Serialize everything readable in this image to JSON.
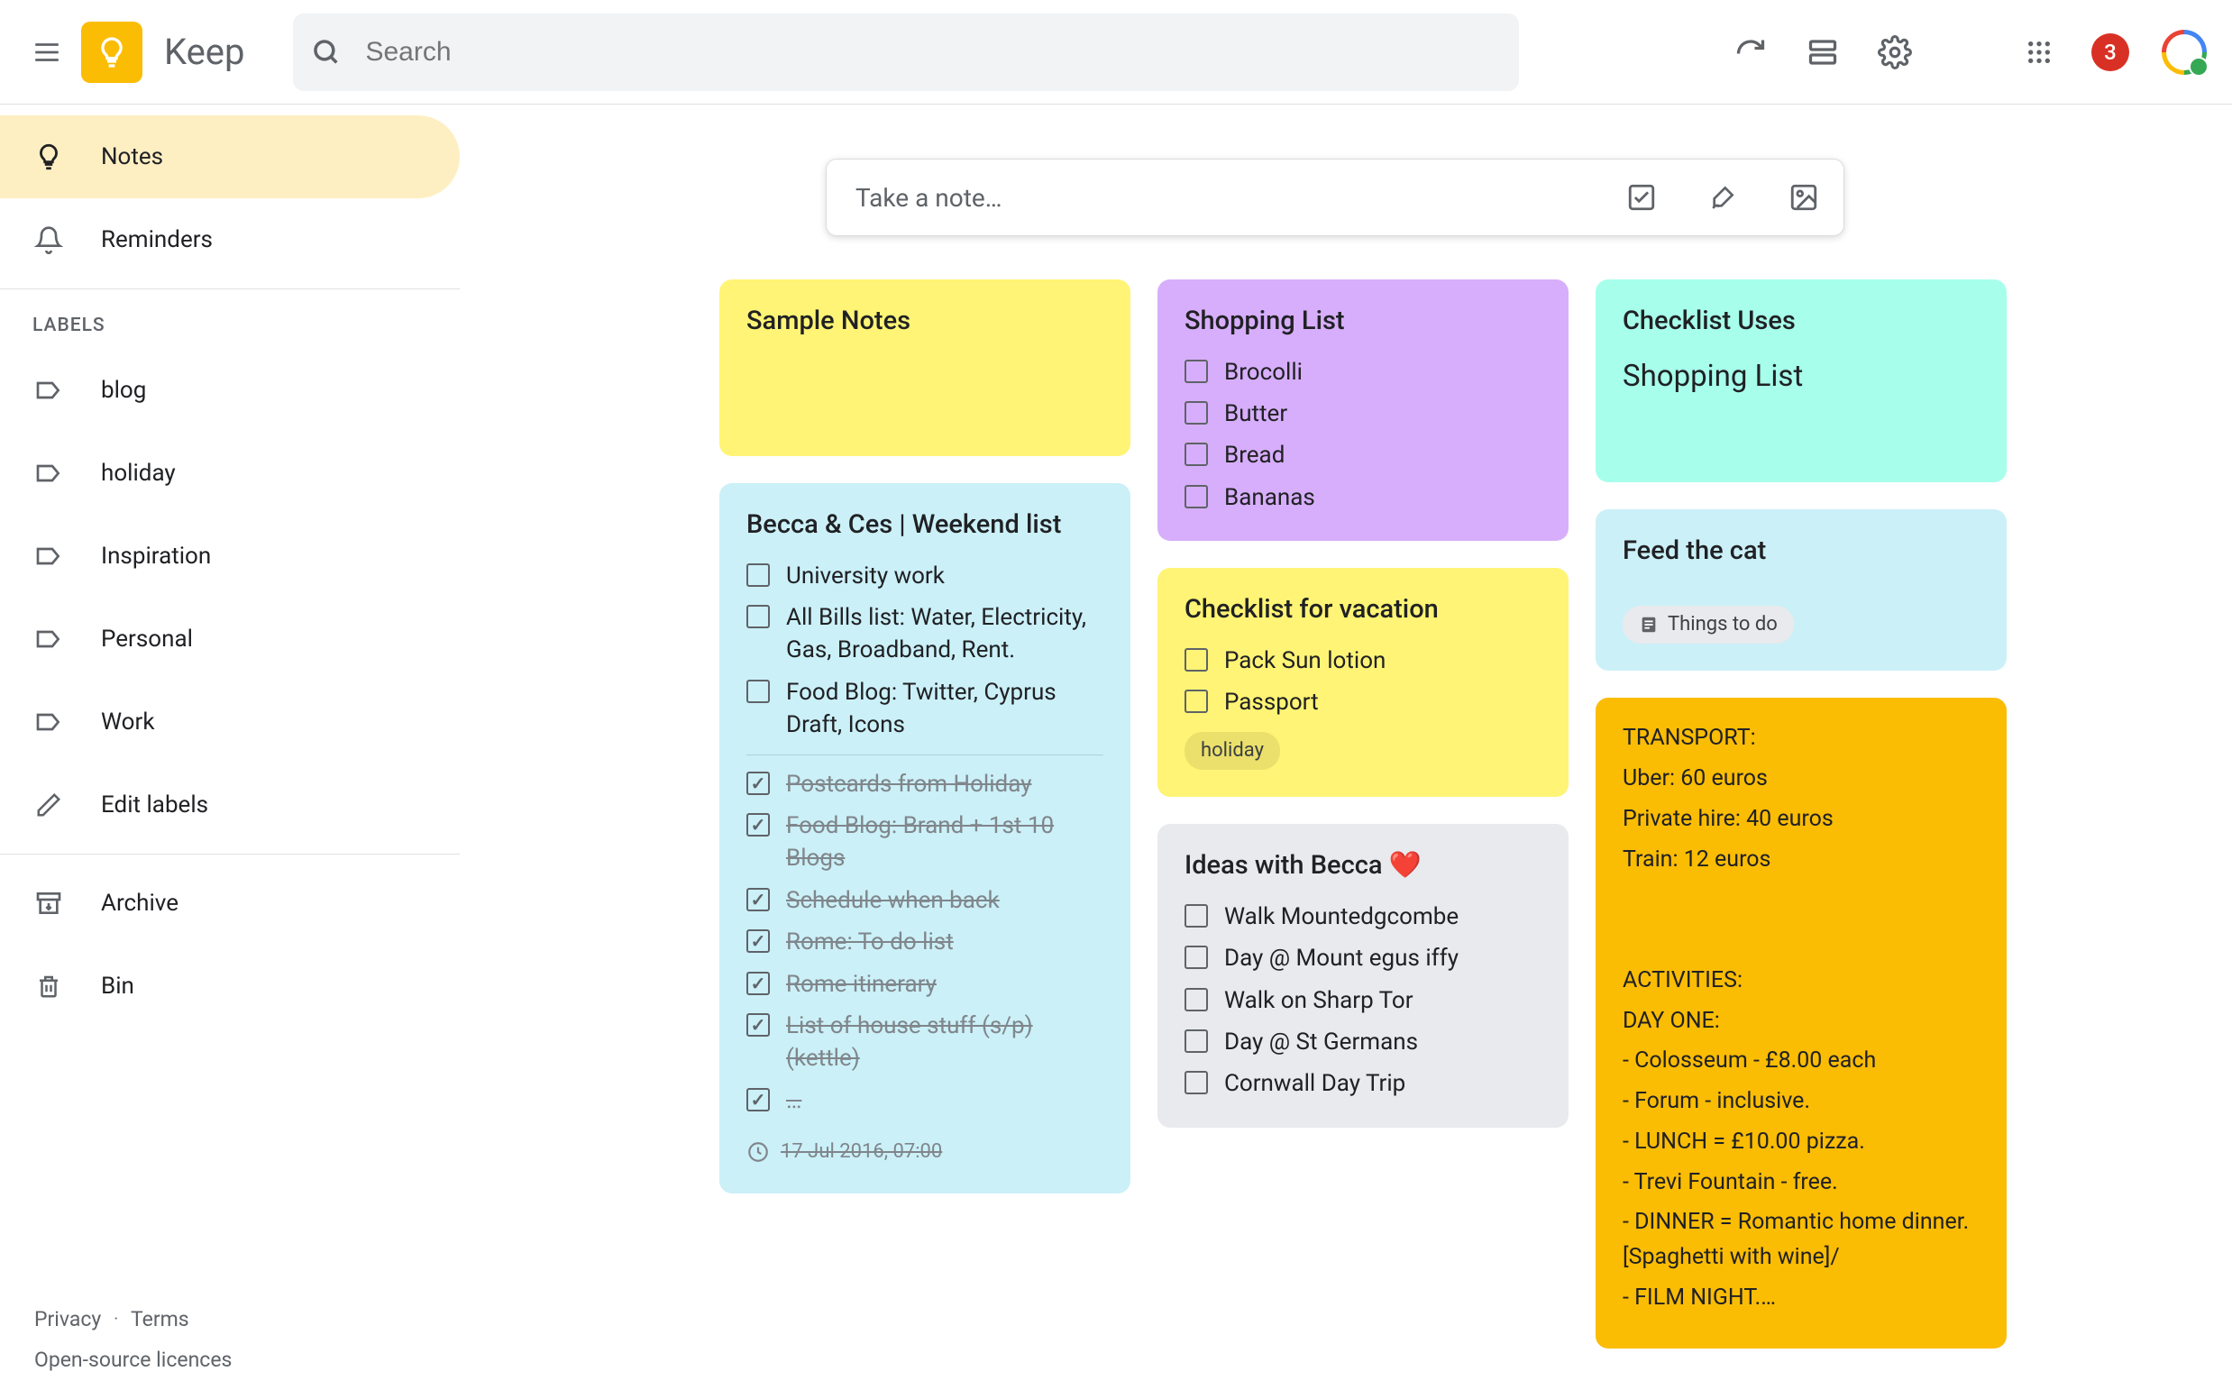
{
  "app_name": "Keep",
  "search_placeholder": "Search",
  "notification_count": "3",
  "sidebar": {
    "notes": "Notes",
    "reminders": "Reminders",
    "labels_heading": "LABELS",
    "labels": [
      "blog",
      "holiday",
      "Inspiration",
      "Personal",
      "Work"
    ],
    "edit_labels": "Edit labels",
    "archive": "Archive",
    "bin": "Bin"
  },
  "footer": {
    "privacy": "Privacy",
    "terms": "Terms",
    "licences": "Open-source licences"
  },
  "take_note_placeholder": "Take a note…",
  "notes": {
    "sample": {
      "title": "Sample Notes"
    },
    "weekend": {
      "title": "Becca & Ces | Weekend list",
      "items_open": [
        "University work",
        "All Bills list: Water, Electricity, Gas, Broadband, Rent.",
        "Food Blog: Twitter, Cyprus Draft, Icons"
      ],
      "items_done": [
        "Postcards from Holiday",
        "Food Blog: Brand + 1st 10 Blogs",
        "Schedule when back",
        "Rome: To do list",
        "Rome itinerary",
        "List of house stuff (s/p) (kettle)",
        "…"
      ],
      "reminder": "17 Jul 2016, 07:00"
    },
    "shopping": {
      "title": "Shopping List",
      "items": [
        "Brocolli",
        "Butter",
        "Bread",
        "Bananas"
      ]
    },
    "vacation": {
      "title": "Checklist for vacation",
      "items": [
        "Pack Sun lotion",
        "Passport"
      ],
      "tag": "holiday"
    },
    "ideas": {
      "title": "Ideas with Becca ❤️",
      "items": [
        "Walk Mountedgcombe",
        "Day @ Mount egus iffy",
        "Walk on Sharp Tor",
        "Day @ St Germans",
        "Cornwall Day Trip"
      ]
    },
    "checklist_uses": {
      "title": "Checklist Uses",
      "subtitle": "Shopping List"
    },
    "feedcat": {
      "title": "Feed the cat",
      "chip": "Things to do"
    },
    "transport": {
      "lines": [
        "TRANSPORT:",
        "Uber: 60 euros",
        "Private hire: 40 euros",
        "Train: 12 euros",
        "",
        "",
        "ACTIVITIES:",
        "DAY ONE:",
        "- Colosseum - £8.00 each",
        "- Forum - inclusive.",
        "- LUNCH = £10.00 pizza.",
        "- Trevi Fountain - free.",
        "- DINNER = Romantic home dinner. [Spaghetti with wine]/",
        "- FILM NIGHT.…"
      ]
    }
  }
}
